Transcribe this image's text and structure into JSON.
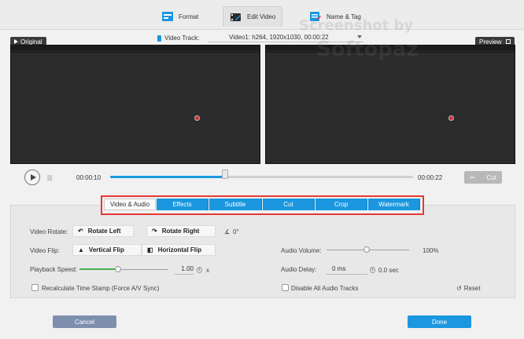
{
  "tabs": [
    {
      "label": "Format",
      "icon": "format-icon",
      "active": false
    },
    {
      "label": "Edit Video",
      "icon": "edit-video-icon",
      "active": true
    },
    {
      "label": "Name & Tag",
      "icon": "name-tag-icon",
      "active": false
    }
  ],
  "watermark": {
    "line1": "Screenshot by",
    "line2": "Softopaz"
  },
  "video_track": {
    "label": "Video Track:",
    "value": "Video1: h264, 1920x1030, 00:00:22"
  },
  "panels": {
    "original_label": "Original",
    "preview_label": "Preview"
  },
  "playback": {
    "current_time": "00:00:10",
    "total_time": "00:00:22",
    "progress": 0.38,
    "cut_label": "Cut"
  },
  "edit_tabs": [
    {
      "label": "Video & Audio",
      "active": true
    },
    {
      "label": "Effects",
      "active": false
    },
    {
      "label": "Subtitle",
      "active": false
    },
    {
      "label": "Cut",
      "active": false
    },
    {
      "label": "Crop",
      "active": false
    },
    {
      "label": "Watermark",
      "active": false
    }
  ],
  "video_audio": {
    "rotate_label": "Video Rotate:",
    "rotate_left": "Rotate Left",
    "rotate_right": "Rotate Right",
    "rotation_value": "0°",
    "flip_label": "Video Flip:",
    "vertical_flip": "Vertical Flip",
    "horizontal_flip": "Horizontal Flip",
    "speed_label": "Playback Speed:",
    "speed_value": "1.00",
    "speed_unit": "x",
    "recalc_label": "Recalculate Time Stamp (Force A/V Sync)",
    "audio_volume_label": "Audio Volume:",
    "audio_volume_value": "100%",
    "audio_delay_label": "Audio Delay:",
    "audio_delay_ms": "0 ms",
    "audio_delay_sec": "0.0 sec",
    "disable_audio_label": "Disable All Audio Tracks",
    "reset_label": "Reset"
  },
  "footer": {
    "cancel": "Cancel",
    "done": "Done"
  },
  "colors": {
    "accent": "#1a97df",
    "highlight": "#e53935",
    "speed_fill": "#4caf50"
  }
}
